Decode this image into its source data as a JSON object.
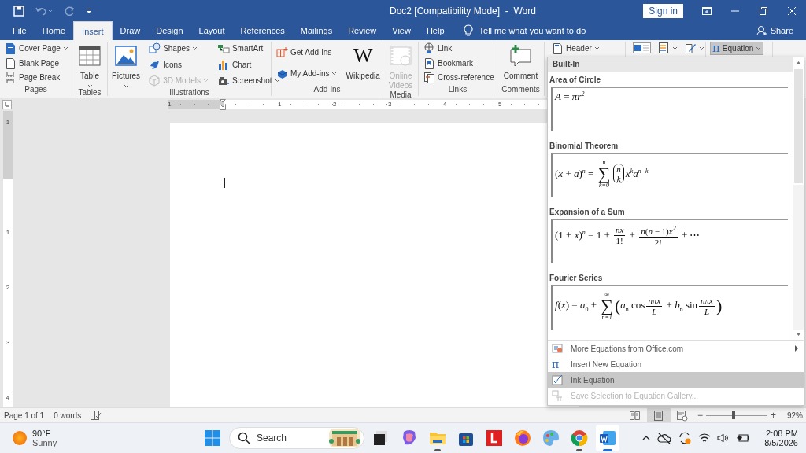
{
  "title_bar": {
    "title": "Doc2 [Compatibility Mode]  -  Word",
    "sign_in": "Sign in"
  },
  "tabs": [
    {
      "label": "File",
      "selected": false
    },
    {
      "label": "Home",
      "selected": false
    },
    {
      "label": "Insert",
      "selected": true
    },
    {
      "label": "Draw",
      "selected": false
    },
    {
      "label": "Design",
      "selected": false
    },
    {
      "label": "Layout",
      "selected": false
    },
    {
      "label": "References",
      "selected": false
    },
    {
      "label": "Mailings",
      "selected": false
    },
    {
      "label": "Review",
      "selected": false
    },
    {
      "label": "View",
      "selected": false
    },
    {
      "label": "Help",
      "selected": false
    }
  ],
  "tell_me": {
    "placeholder": "Tell me what you want to do"
  },
  "share": "Share",
  "ribbon_groups": [
    {
      "label": "Pages",
      "items": [
        {
          "kind": "small",
          "label": "Cover Page",
          "dropdown": true,
          "disabled": false,
          "pressed": false
        },
        {
          "kind": "small",
          "label": "Blank Page",
          "dropdown": false,
          "disabled": false,
          "pressed": false
        },
        {
          "kind": "small",
          "label": "Page Break",
          "dropdown": false,
          "disabled": false,
          "pressed": false
        }
      ]
    },
    {
      "label": "Tables",
      "items": [
        {
          "kind": "large",
          "label": "Table",
          "dropdown": true,
          "disabled": false,
          "pressed": false
        }
      ]
    },
    {
      "label": "Illustrations",
      "items": [
        {
          "kind": "large",
          "label": "Pictures",
          "dropdown": true,
          "disabled": false,
          "pressed": false
        },
        {
          "kind": "small",
          "label": "Shapes",
          "dropdown": true,
          "disabled": false,
          "pressed": false
        },
        {
          "kind": "small",
          "label": "Icons",
          "dropdown": false,
          "disabled": false,
          "pressed": false
        },
        {
          "kind": "small",
          "label": "3D Models",
          "dropdown": true,
          "disabled": true,
          "pressed": false
        },
        {
          "kind": "small",
          "label": "SmartArt",
          "dropdown": false,
          "disabled": false,
          "pressed": false
        },
        {
          "kind": "small",
          "label": "Chart",
          "dropdown": false,
          "disabled": false,
          "pressed": false
        },
        {
          "kind": "small",
          "label": "Screenshot",
          "dropdown": true,
          "disabled": false,
          "pressed": false
        }
      ]
    },
    {
      "label": "Add-ins",
      "items": [
        {
          "kind": "small",
          "label": "Get Add-ins",
          "dropdown": false,
          "disabled": false,
          "pressed": false
        },
        {
          "kind": "small",
          "label": "My Add-ins",
          "dropdown": true,
          "disabled": false,
          "pressed": false
        },
        {
          "kind": "large",
          "label": "Wikipedia",
          "glyph": "W",
          "dropdown": false,
          "disabled": false,
          "pressed": false
        }
      ]
    },
    {
      "label": "Media",
      "items": [
        {
          "kind": "large",
          "label": "Online Videos",
          "dropdown": false,
          "disabled": true,
          "pressed": false
        }
      ]
    },
    {
      "label": "Links",
      "items": [
        {
          "kind": "small",
          "label": "Link",
          "dropdown": false,
          "disabled": false,
          "pressed": false
        },
        {
          "kind": "small",
          "label": "Bookmark",
          "dropdown": false,
          "disabled": false,
          "pressed": false
        },
        {
          "kind": "small",
          "label": "Cross-reference",
          "dropdown": false,
          "disabled": false,
          "pressed": false
        }
      ]
    },
    {
      "label": "Comments",
      "items": [
        {
          "kind": "large",
          "label": "Comment",
          "dropdown": false,
          "disabled": false,
          "pressed": false
        }
      ]
    },
    {
      "items": [
        {
          "kind": "small",
          "label": "Header",
          "dropdown": true,
          "disabled": false,
          "pressed": false
        }
      ]
    },
    {
      "items": [
        {
          "kind": "icon",
          "dropdown": false,
          "disabled": false,
          "pressed": false
        },
        {
          "kind": "icon",
          "dropdown": true,
          "disabled": false,
          "pressed": false
        },
        {
          "kind": "icon",
          "dropdown": true,
          "disabled": false,
          "pressed": false
        }
      ]
    },
    {
      "items": [
        {
          "kind": "small",
          "label": "Equation",
          "glyph": "π",
          "dropdown": true,
          "disabled": false,
          "pressed": true
        }
      ]
    }
  ],
  "ruler": {
    "h_numbers": [
      "1",
      "1",
      "2",
      "3",
      "4",
      "5"
    ],
    "v_numbers": [
      "1",
      "1",
      "2",
      "3",
      "4"
    ]
  },
  "equation_menu": {
    "header": "Built-In",
    "equations": [
      {
        "title": "Area of Circle",
        "parts": [
          {
            "kind": "text",
            "text": "*A* = *πr*$^{2}$"
          }
        ]
      },
      {
        "title": "Binomial Theorem",
        "parts": [
          {
            "kind": "text",
            "text": "(*x* + *a*)$^{n}$ = "
          },
          {
            "kind": "sum",
            "symbol": "∑",
            "upper": "n",
            "lower": "k=0"
          },
          {
            "kind": "binom",
            "top": "n",
            "bottom": "k"
          },
          {
            "kind": "text",
            "text": "*x*$^{k}$*a*$^{n−k}$"
          }
        ]
      },
      {
        "title": "Expansion of a Sum",
        "parts": [
          {
            "kind": "text",
            "text": "(1 + *x*)$^{n}$ = 1 + "
          },
          {
            "kind": "frac",
            "num": "*nx*",
            "den": "1!"
          },
          {
            "kind": "text",
            "text": " + "
          },
          {
            "kind": "frac",
            "num": "*n*(*n* − 1)*x*$^{2}$",
            "den": "2!"
          },
          {
            "kind": "text",
            "text": " + ⋯"
          }
        ]
      },
      {
        "title": "Fourier Series",
        "parts": [
          {
            "kind": "text",
            "text": "*f*(*x*) = *a*$_{0}$ + "
          },
          {
            "kind": "sum",
            "symbol": "∑",
            "upper": "∞",
            "lower": "n=1"
          },
          {
            "kind": "big",
            "text": "("
          },
          {
            "kind": "text",
            "text": "*a*$_{n}$ cos"
          },
          {
            "kind": "frac",
            "num": "*nπx*",
            "den": "*L*"
          },
          {
            "kind": "text",
            "text": " + *b*$_{n}$ sin"
          },
          {
            "kind": "frac",
            "num": "*nπx*",
            "den": "*L*"
          },
          {
            "kind": "big",
            "text": ")"
          }
        ]
      }
    ],
    "items": [
      {
        "label": "More Equations from Office.com",
        "submenu": true,
        "disabled": false,
        "selected": false
      },
      {
        "label": "Insert New Equation",
        "glyph": "π",
        "submenu": false,
        "disabled": false,
        "selected": false
      },
      {
        "label": "Ink Equation",
        "submenu": false,
        "disabled": false,
        "selected": true
      },
      {
        "label": "Save Selection to Equation Gallery...",
        "submenu": false,
        "disabled": true,
        "selected": false
      }
    ]
  },
  "status_bar": {
    "page": "Page 1 of 1",
    "words": "0 words",
    "views": [
      {
        "selected": false
      },
      {
        "selected": true
      },
      {
        "selected": false
      }
    ],
    "zoom": {
      "minus": "−",
      "plus": "+",
      "level": 0.45,
      "percent": "92%"
    }
  },
  "taskbar": {
    "weather": {
      "temperature": "90°F",
      "condition": "Sunny"
    },
    "search": {
      "placeholder": "Search"
    },
    "apps": [
      {
        "running": false,
        "active": false
      },
      {
        "running": false,
        "active": false
      },
      {
        "running": true,
        "active": false
      },
      {
        "running": false,
        "active": false
      },
      {
        "running": false,
        "active": false
      },
      {
        "running": false,
        "active": false
      },
      {
        "running": false,
        "active": false
      },
      {
        "running": true,
        "active": false
      },
      {
        "running": true,
        "active": true
      }
    ],
    "time": "2:08 PM",
    "date": "8/5/2026"
  }
}
